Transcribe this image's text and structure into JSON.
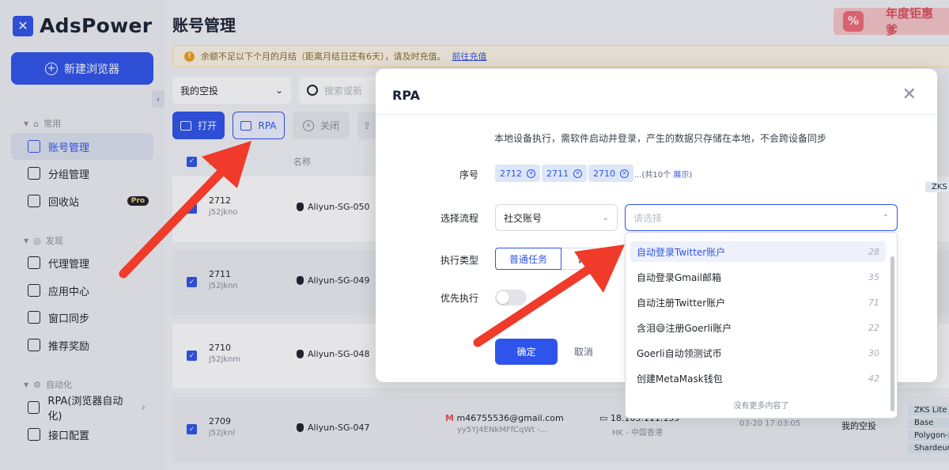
{
  "app": {
    "name": "AdsPower",
    "new_browser": "新建浏览器"
  },
  "sidebar": {
    "sections": [
      {
        "title": "常用"
      },
      {
        "title": "发现"
      },
      {
        "title": "自动化"
      }
    ],
    "items": [
      {
        "label": "账号管理"
      },
      {
        "label": "分组管理"
      },
      {
        "label": "回收站",
        "badge": "Pro"
      },
      {
        "label": "代理管理"
      },
      {
        "label": "应用中心"
      },
      {
        "label": "窗口同步"
      },
      {
        "label": "推荐奖励"
      },
      {
        "label": "RPA(浏览器自动化)"
      },
      {
        "label": "接口配置"
      }
    ]
  },
  "header": {
    "title": "账号管理",
    "promo": "年度钜惠 爹"
  },
  "notice": {
    "text": "余额不足以下个月的月结（距离月结日还有6天），请及时充值。",
    "link": "前往充值"
  },
  "toolbar": {
    "group": "我的空投",
    "search_placeholder": "搜索或新",
    "open": "打开",
    "rpa": "RPA",
    "close": "关闭"
  },
  "table": {
    "headers": {
      "seq": "序号",
      "name": "名称"
    },
    "rows": [
      {
        "seq": "2712",
        "user": "j52jkno",
        "name": "Aliyun-SG-050"
      },
      {
        "seq": "2711",
        "user": "j52jknn",
        "name": "Aliyun-SG-049"
      },
      {
        "seq": "2710",
        "user": "j52jknm",
        "name": "Aliyun-SG-048"
      },
      {
        "seq": "2709",
        "user": "j52jknl",
        "name": "Aliyun-SG-047",
        "email": "m46755536@gmail.com",
        "email_sub": "yy5YJ4ENkMFfCqWt -...",
        "ip": "18.163.111.159",
        "region": "HK - 中国香港",
        "date": "03-20 17:03:05",
        "group": "我的空投"
      }
    ],
    "tags": [
      "ZKS Lite",
      "Base",
      "Polygon-zk",
      "Shardeum"
    ]
  },
  "modal": {
    "title": "RPA",
    "description": "本地设备执行，需软件启动并登录，产生的数据只存储在本地，不会跨设备同步",
    "seq_label": "序号",
    "seq_chips": [
      "2712",
      "2711",
      "2710"
    ],
    "seq_more_prefix": "...(共10个",
    "seq_more_link": "展示",
    "seq_more_suffix": ")",
    "flow_label": "选择流程",
    "flow_value": "社交账号",
    "process_placeholder": "请选择",
    "type_label": "执行类型",
    "type_normal": "普通任务",
    "type_other": "计",
    "priority_label": "优先执行",
    "ok": "确定",
    "cancel": "取消"
  },
  "dropdown": {
    "items": [
      {
        "label": "自动登录Twitter账户",
        "count": "28"
      },
      {
        "label": "自动登录Gmail邮箱",
        "count": "35"
      },
      {
        "label": "自动注册Twitter账户",
        "count": "71"
      },
      {
        "label": "含泪😅注册Goerli账户",
        "count": "22"
      },
      {
        "label": "Goerli自动领测试币",
        "count": "30"
      },
      {
        "label": "创建MetaMask钱包",
        "count": "42"
      }
    ],
    "end_text": "没有更多内容了"
  },
  "colors": {
    "primary": "#2f54eb",
    "arrow": "#f03a2a"
  }
}
